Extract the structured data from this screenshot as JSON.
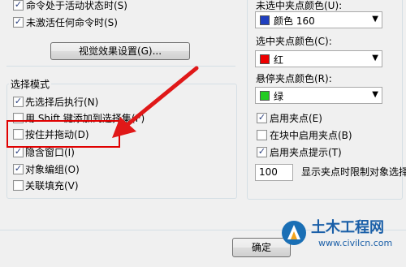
{
  "left_panel": {
    "top_checks": [
      {
        "label": "命令处于活动状态时(S)",
        "checked": true
      },
      {
        "label": "未激活任何命令时(S)",
        "checked": true
      }
    ],
    "visual_effects_button": "视觉效果设置(G)...",
    "selection_mode": {
      "title": "选择模式",
      "items": [
        {
          "label": "先选择后执行(N)",
          "checked": true
        },
        {
          "label": "用 Shift 键添加到选择集(F)",
          "checked": false
        },
        {
          "label": "按住并拖动(D)",
          "checked": false
        },
        {
          "label": "隐含窗口(I)",
          "checked": true
        },
        {
          "label": "对象编组(O)",
          "checked": true
        },
        {
          "label": "关联填充(V)",
          "checked": false
        }
      ]
    }
  },
  "right_panel": {
    "unselected_grip_label": "未选中夹点颜色(U):",
    "unselected_grip_value": "颜色 160",
    "unselected_grip_color": "#1f3fbf",
    "selected_grip_label": "选中夹点颜色(C):",
    "selected_grip_value": "红",
    "selected_grip_color": "#ee0000",
    "hover_grip_label": "悬停夹点颜色(R):",
    "hover_grip_value": "绿",
    "hover_grip_color": "#22cc22",
    "checks": [
      {
        "label": "启用夹点(E)",
        "checked": true
      },
      {
        "label": "在块中启用夹点(B)",
        "checked": false
      },
      {
        "label": "启用夹点提示(T)",
        "checked": true
      }
    ],
    "grip_limit_value": "100",
    "grip_limit_label": "显示夹点时限制对象选择"
  },
  "footer": {
    "ok_button": "确定"
  },
  "watermark": {
    "title": "土木工程网",
    "url": "www.civilcn.com"
  },
  "colors": {
    "highlight_box": "#e00000",
    "arrow": "#e01818"
  }
}
